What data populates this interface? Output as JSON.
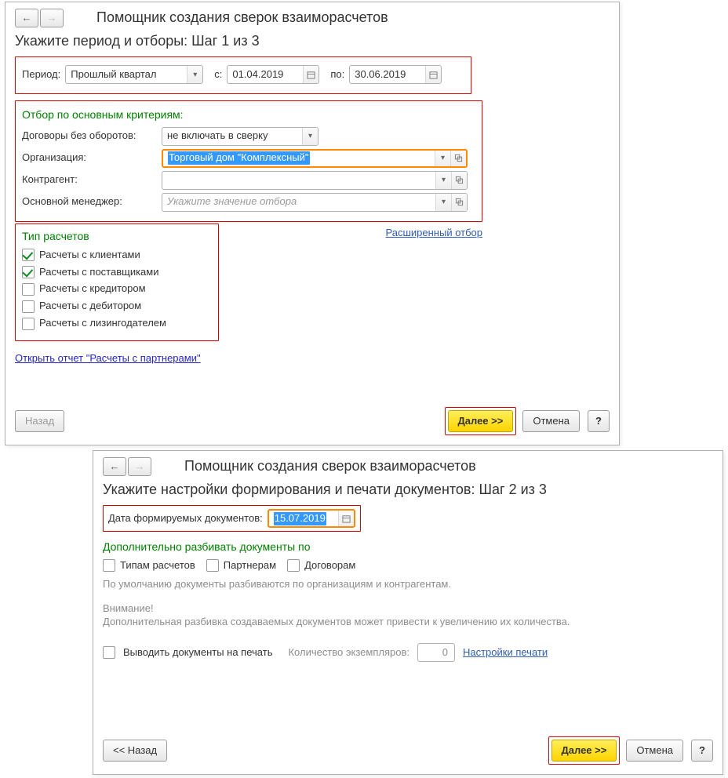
{
  "window1": {
    "title": "Помощник создания сверок взаиморасчетов",
    "section": "Укажите период и отборы:  Шаг 1 из 3",
    "period": {
      "label": "Период:",
      "preset": "Прошлый квартал",
      "from_label": "с:",
      "from": "01.04.2019",
      "to_label": "по:",
      "to": "30.06.2019"
    },
    "criteria": {
      "title": "Отбор по основным критериям:",
      "rows": {
        "no_turnover": {
          "label": "Договоры без оборотов:",
          "value": "не включать в сверку"
        },
        "org": {
          "label": "Организация:",
          "value": "Торговый дом \"Комплексный\""
        },
        "counterparty": {
          "label": "Контрагент:",
          "value": ""
        },
        "manager": {
          "label": "Основной менеджер:",
          "placeholder": "Укажите значение отбора"
        }
      }
    },
    "advanced_link": "Расширенный отбор",
    "calc_type": {
      "title": "Тип расчетов",
      "items": [
        {
          "label": "Расчеты с клиентами",
          "checked": true
        },
        {
          "label": "Расчеты с поставщиками",
          "checked": true
        },
        {
          "label": "Расчеты с кредитором",
          "checked": false
        },
        {
          "label": "Расчеты с дебитором",
          "checked": false
        },
        {
          "label": "Расчеты с лизингодателем",
          "checked": false
        }
      ]
    },
    "report_link": "Открыть отчет \"Расчеты с партнерами\"",
    "buttons": {
      "back": "Назад",
      "next": "Далее >>",
      "cancel": "Отмена",
      "help": "?"
    }
  },
  "window2": {
    "title": "Помощник создания сверок взаиморасчетов",
    "section": "Укажите настройки формирования и печати документов:  Шаг 2 из 3",
    "date": {
      "label": "Дата формируемых документов:",
      "value": "15.07.2019"
    },
    "split": {
      "title": "Дополнительно разбивать документы по",
      "items": [
        {
          "label": "Типам расчетов",
          "checked": false
        },
        {
          "label": "Партнерам",
          "checked": false
        },
        {
          "label": "Договорам",
          "checked": false
        }
      ],
      "hint": "По умолчанию документы разбиваются по организациям и контрагентам."
    },
    "warn": {
      "title": "Внимание!",
      "text": "Дополнительная разбивка создаваемых документов может привести к увеличению их количества."
    },
    "print": {
      "checkbox": "Выводить документы на печать",
      "copies_label": "Количество экземпляров:",
      "copies": "0",
      "settings": "Настройки печати"
    },
    "buttons": {
      "back": "<< Назад",
      "next": "Далее >>",
      "cancel": "Отмена",
      "help": "?"
    }
  }
}
